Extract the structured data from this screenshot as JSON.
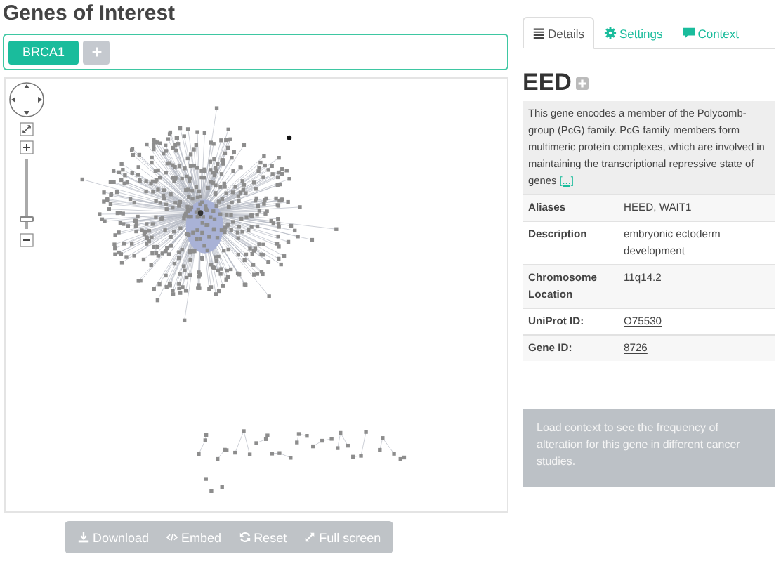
{
  "header": {
    "title": "Genes of Interest"
  },
  "genes": {
    "items": [
      {
        "label": "BRCA1",
        "selected": true
      }
    ]
  },
  "network": {
    "zoom": {
      "level": 0.1
    }
  },
  "actions": [
    {
      "label": "Download",
      "kind": "download"
    },
    {
      "label": "Embed",
      "kind": "embed"
    },
    {
      "label": "Reset",
      "kind": "reset"
    },
    {
      "label": "Full screen",
      "kind": "fullscreen"
    }
  ],
  "tabs": [
    {
      "label": "Details",
      "kind": "list",
      "selected": true
    },
    {
      "label": "Settings",
      "kind": "gear",
      "selected": false
    },
    {
      "label": "Context",
      "kind": "comment",
      "selected": false
    }
  ],
  "gene": {
    "symbol": "EED",
    "summary": "This gene encodes a member of the Polycomb-group (PcG) family. PcG family members form multimeric protein complexes, which are involved in maintaining the transcriptional repressive state of genes",
    "more_link": "[...]",
    "fields": [
      {
        "label": "Aliases",
        "value": "HEED, WAIT1",
        "kind": "text"
      },
      {
        "label": "Description",
        "value": "embryonic ectoderm development",
        "kind": "text"
      },
      {
        "label": "Chromosome Location",
        "value": "11q14.2",
        "kind": "text"
      },
      {
        "label": "UniProt ID:",
        "value": "O75530",
        "kind": "link"
      },
      {
        "label": "Gene ID:",
        "value": "8726",
        "kind": "link"
      }
    ]
  },
  "context_message": "Load context to see the frequency of alteration for this gene in different cancer studies."
}
